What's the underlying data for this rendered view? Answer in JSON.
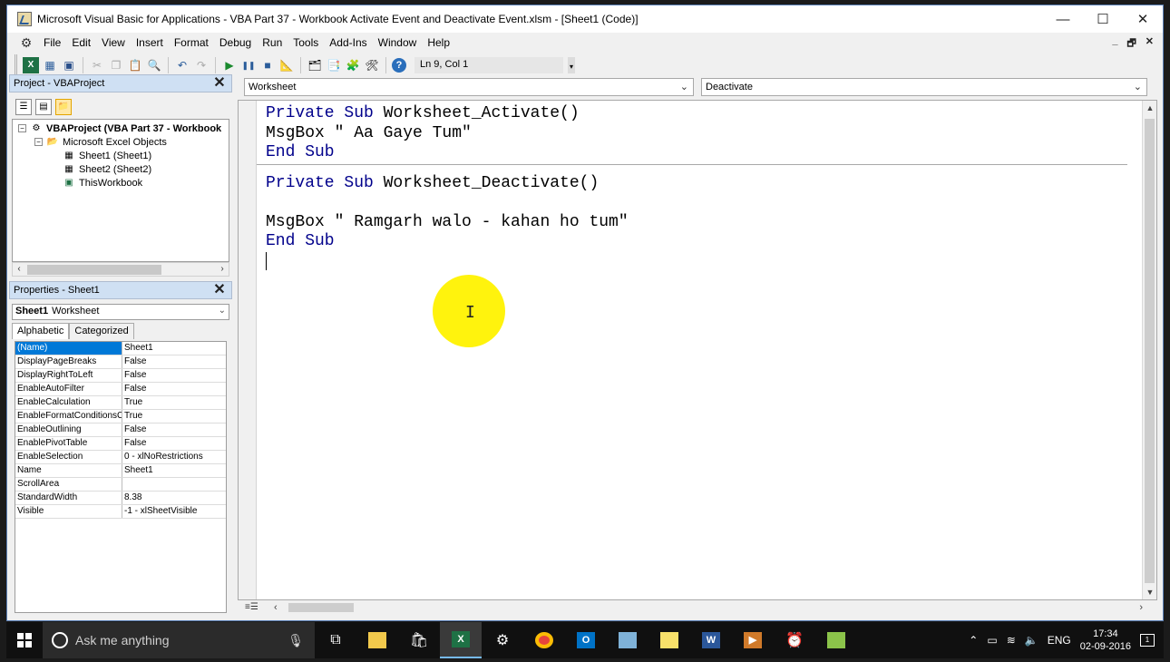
{
  "window": {
    "title": "Microsoft Visual Basic for Applications - VBA Part 37 - Workbook Activate Event and Deactivate Event.xlsm - [Sheet1 (Code)]",
    "minimize": "—",
    "maximize": "☐",
    "close": "✕"
  },
  "menu": {
    "items": [
      "File",
      "Edit",
      "View",
      "Insert",
      "Format",
      "Debug",
      "Run",
      "Tools",
      "Add-Ins",
      "Window",
      "Help"
    ],
    "mdi_min": "_",
    "mdi_restore": "🗗",
    "mdi_close": "✕"
  },
  "toolbar": {
    "position": "Ln 9, Col 1"
  },
  "project": {
    "title": "Project - VBAProject",
    "close": "✕",
    "tree": [
      {
        "label": "VBAProject (VBA Part 37 - Workbook",
        "level": 0,
        "bold": true
      },
      {
        "label": "Microsoft Excel Objects",
        "level": 1
      },
      {
        "label": "Sheet1 (Sheet1)",
        "level": 2
      },
      {
        "label": "Sheet2 (Sheet2)",
        "level": 2
      },
      {
        "label": "ThisWorkbook",
        "level": 2
      }
    ]
  },
  "properties": {
    "title": "Properties - Sheet1",
    "close": "✕",
    "object_name": "Sheet1",
    "object_type": "Worksheet",
    "tabs": [
      "Alphabetic",
      "Categorized"
    ],
    "rows": [
      {
        "name": "(Name)",
        "value": "Sheet1"
      },
      {
        "name": "DisplayPageBreaks",
        "value": "False"
      },
      {
        "name": "DisplayRightToLeft",
        "value": "False"
      },
      {
        "name": "EnableAutoFilter",
        "value": "False"
      },
      {
        "name": "EnableCalculation",
        "value": "True"
      },
      {
        "name": "EnableFormatConditionsC",
        "value": "True"
      },
      {
        "name": "EnableOutlining",
        "value": "False"
      },
      {
        "name": "EnablePivotTable",
        "value": "False"
      },
      {
        "name": "EnableSelection",
        "value": "0 - xlNoRestrictions"
      },
      {
        "name": "Name",
        "value": "Sheet1"
      },
      {
        "name": "ScrollArea",
        "value": ""
      },
      {
        "name": "StandardWidth",
        "value": "8.38"
      },
      {
        "name": "Visible",
        "value": "-1 - xlSheetVisible"
      }
    ]
  },
  "code": {
    "object_combo": "Worksheet",
    "procedure_combo": "Deactivate",
    "block1": [
      {
        "kw": "Private Sub ",
        "text": "Worksheet_Activate()"
      },
      {
        "kw": "",
        "text": "MsgBox \" Aa Gaye Tum\""
      },
      {
        "kw": "End Sub",
        "text": ""
      }
    ],
    "block2": [
      {
        "kw": "Private Sub ",
        "text": "Worksheet_Deactivate()"
      },
      {
        "kw": "",
        "text": ""
      },
      {
        "kw": "",
        "text": "MsgBox \" Ramgarh walo - kahan ho tum\""
      },
      {
        "kw": "End Sub",
        "text": ""
      }
    ]
  },
  "taskbar": {
    "search_placeholder": "Ask me anything",
    "language": "ENG",
    "time": "17:34",
    "date": "02-09-2016",
    "notification_count": "1"
  },
  "colors": {
    "keyword": "#00008b",
    "selection": "#0078d7",
    "cursor_highlight": "#fff200"
  }
}
